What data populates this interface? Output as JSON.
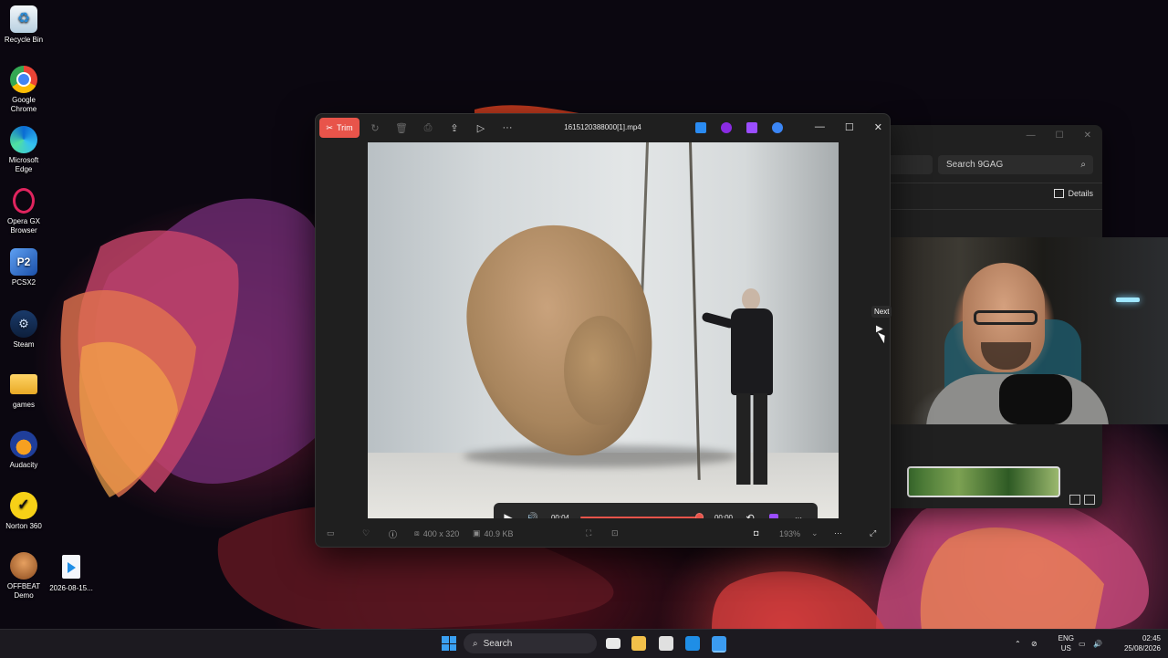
{
  "desktop": {
    "icons": [
      {
        "label": "Recycle Bin",
        "icon": "recycle-bin-icon",
        "color": "#cfe6f5"
      },
      {
        "label": "Google Chrome",
        "icon": "chrome-icon",
        "color": "#ea4335"
      },
      {
        "label": "Microsoft Edge",
        "icon": "edge-icon",
        "color": "#1fa0e0"
      },
      {
        "label": "Opera GX Browser",
        "icon": "opera-gx-icon",
        "color": "#e0245e"
      },
      {
        "label": "PCSX2",
        "icon": "pcsx2-icon",
        "color": "#2a6fd6"
      },
      {
        "label": "Steam",
        "icon": "steam-icon",
        "color": "#1b2838"
      },
      {
        "label": "games",
        "icon": "folder-icon",
        "color": "#f2c04a"
      },
      {
        "label": "Audacity",
        "icon": "audacity-icon",
        "color": "#1f3e9a"
      },
      {
        "label": "Norton 360",
        "icon": "norton-icon",
        "color": "#f7d117"
      },
      {
        "label": "OFFBEAT Demo",
        "icon": "offbeat-icon",
        "color": "#b6652e"
      }
    ],
    "extra_file": {
      "label": "2026-08-15...",
      "icon": "video-file-icon"
    }
  },
  "background_window": {
    "search_placeholder": "Search 9GAG",
    "details_label": "Details"
  },
  "player": {
    "trim_label": "Trim",
    "filename": "1615120388000[1].mp4",
    "current_time": "00:04",
    "remaining_time": "00:00",
    "progress": 0.97,
    "dimensions": "400 x 320",
    "file_size": "40.9 KB",
    "zoom": "193%",
    "accent": "#e8544a"
  },
  "tooltip": {
    "next_label": "Next"
  },
  "taskbar": {
    "search_label": "Search",
    "language": "ENG",
    "region": "US",
    "time": "02:45",
    "date": "25/08/2026"
  }
}
